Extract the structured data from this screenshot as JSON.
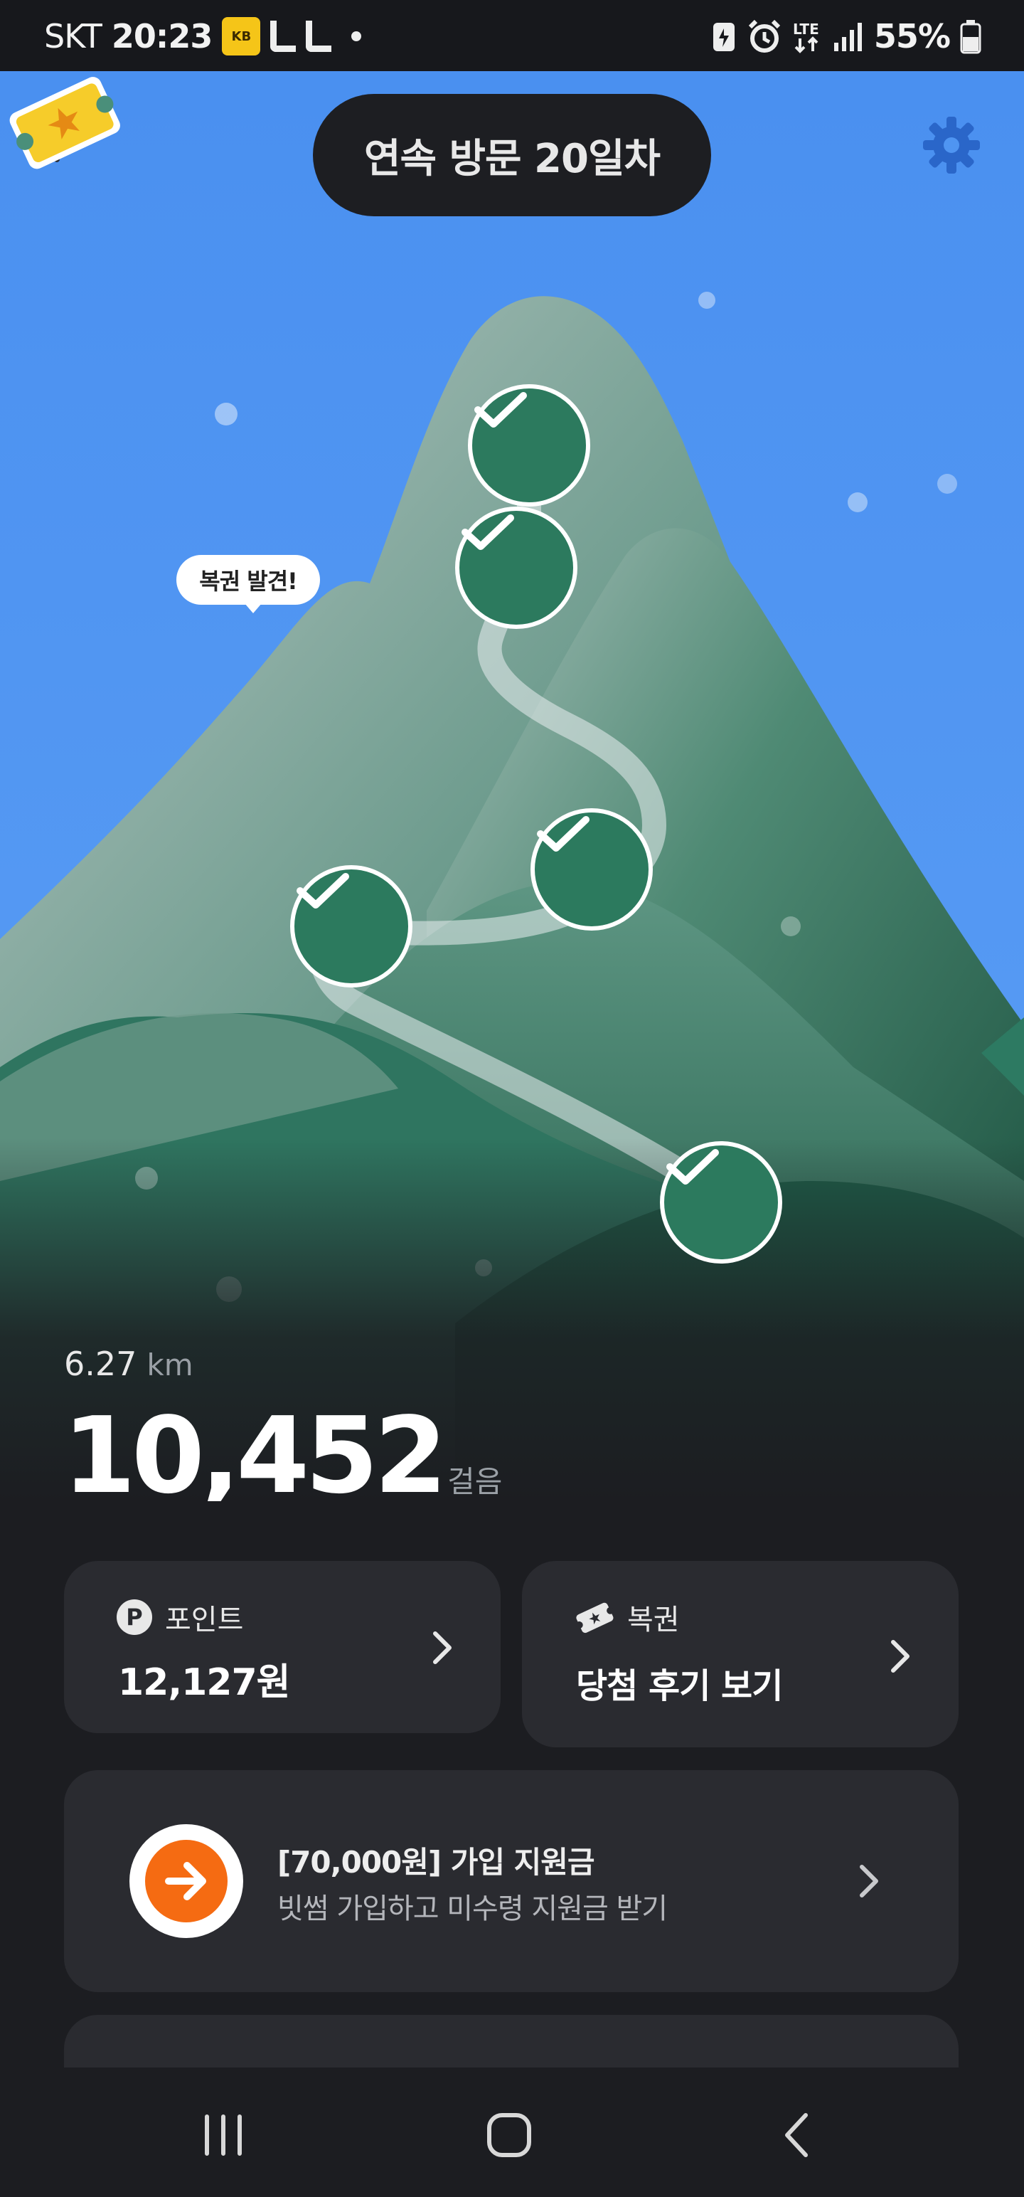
{
  "status_bar": {
    "carrier": "SKT",
    "time": "20:23",
    "battery": "55%",
    "icons": [
      "kb-bank-icon",
      "l-app-icon",
      "l-app-icon",
      "notification-dot-icon",
      "battery-saver-icon",
      "alarm-icon",
      "lte-icon",
      "signal-icon",
      "battery-icon"
    ]
  },
  "header": {
    "title": "연속 방문 20일차",
    "back_icon": "arrow-left-icon",
    "settings_icon": "gear-icon"
  },
  "scene": {
    "ticket_bubble": "복권 발견!",
    "ticket_icon": "lottery-ticket-icon",
    "checkpoints": [
      {
        "name": "checkpoint-1",
        "done": true
      },
      {
        "name": "checkpoint-2",
        "done": true
      },
      {
        "name": "checkpoint-3",
        "done": true
      },
      {
        "name": "checkpoint-4",
        "done": true
      },
      {
        "name": "checkpoint-5",
        "done": true
      }
    ]
  },
  "stats": {
    "distance_value": "6.27",
    "distance_unit": "km",
    "steps_value": "10,452",
    "steps_unit": "걸음"
  },
  "cards": {
    "points": {
      "label": "포인트",
      "value": "12,127원",
      "icon": "point-p-icon"
    },
    "lottery": {
      "label": "복권",
      "value": "당첨 후기 보기",
      "icon": "ticket-icon"
    },
    "promo": {
      "title": "[70,000원] 가입 지원금",
      "subtitle": "빗썸 가입하고 미수령 지원금 받기",
      "icon": "arrow-right-circle-icon"
    }
  },
  "nav_bar": {
    "recent": "recent-apps-icon",
    "home": "home-icon",
    "back": "back-chevron-icon"
  },
  "colors": {
    "sky": "#4f95f2",
    "mountain_dark": "#1e5a46",
    "mountain_light": "#9fb6b2",
    "check_fill": "#2c7a5e",
    "promo_orange": "#f56b12",
    "card_bg": "#2a2b30",
    "page_bg": "#1c1d21"
  }
}
